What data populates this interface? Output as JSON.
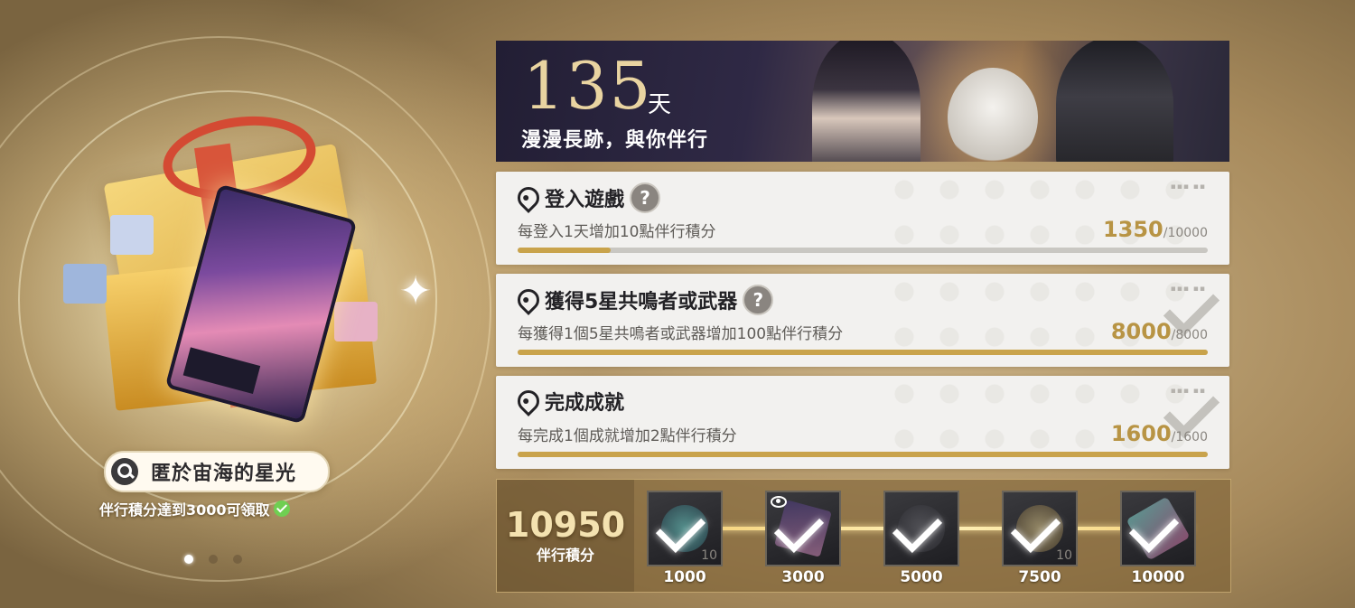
{
  "banner": {
    "days": "135",
    "days_unit": "天",
    "subtitle": "漫漫長跡，與你伴行"
  },
  "reward": {
    "name": "匿於宙海的星光",
    "condition": "伴行積分達到3000可領取"
  },
  "pager": {
    "count": 3,
    "active": 0
  },
  "tasks": [
    {
      "title": "登入遊戲",
      "has_help": true,
      "desc": "每登入1天增加10點伴行積分",
      "current": "1350",
      "target": "/10000",
      "ratio": 0.135,
      "completed": false
    },
    {
      "title": "獲得5星共鳴者或武器",
      "has_help": true,
      "desc": "每獲得1個5星共鳴者或武器增加100點伴行積分",
      "current": "8000",
      "target": "/8000",
      "ratio": 1.0,
      "completed": true
    },
    {
      "title": "完成成就",
      "has_help": false,
      "desc": "每完成1個成就增加2點伴行積分",
      "current": "1600",
      "target": "/1600",
      "ratio": 1.0,
      "completed": true
    }
  ],
  "total": {
    "value": "10950",
    "label": "伴行積分"
  },
  "milestones": [
    {
      "threshold": "1000",
      "qty": "10",
      "claimed": true,
      "icon": "echo-material"
    },
    {
      "threshold": "3000",
      "qty": "",
      "claimed": true,
      "icon": "card-item",
      "preview": true
    },
    {
      "threshold": "5000",
      "qty": "",
      "claimed": true,
      "icon": "bracelet"
    },
    {
      "threshold": "7500",
      "qty": "10",
      "claimed": true,
      "icon": "tide-emblem"
    },
    {
      "threshold": "10000",
      "qty": "",
      "claimed": true,
      "icon": "feather-crystal"
    }
  ],
  "colors": {
    "accent_gold": "#c9a34b",
    "progress_text": "#b89444",
    "check_green": "#6fcf52"
  }
}
